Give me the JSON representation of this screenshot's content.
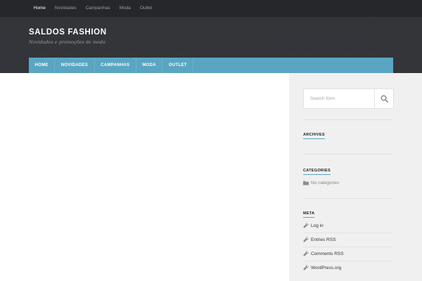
{
  "topbar": {
    "items": [
      "Home",
      "Novidades",
      "Campanhas",
      "Moda",
      "Outlet"
    ]
  },
  "header": {
    "title": "SALDOS FASHION",
    "description": "Novidades e promoções de moda"
  },
  "mainnav": {
    "items": [
      "HOME",
      "NOVIDADES",
      "CAMPANHAS",
      "MODA",
      "OUTLET"
    ]
  },
  "sidebar": {
    "search": {
      "placeholder": "Search form"
    },
    "archives": {
      "title": "ARCHIVES"
    },
    "categories": {
      "title": "CATEGORIES",
      "empty": "No categories"
    },
    "meta": {
      "title": "META",
      "links": [
        "Log in",
        "Entries RSS",
        "Comments RSS",
        "WordPress.org"
      ]
    }
  },
  "colors": {
    "topbar_bg": "#26272b",
    "header_bg": "#323439",
    "accent": "#5aa6c2",
    "sidebar_bg": "#f0f0f0"
  },
  "icons": {
    "search": "search-icon",
    "folder": "folder-icon",
    "wrench": "wrench-icon"
  }
}
